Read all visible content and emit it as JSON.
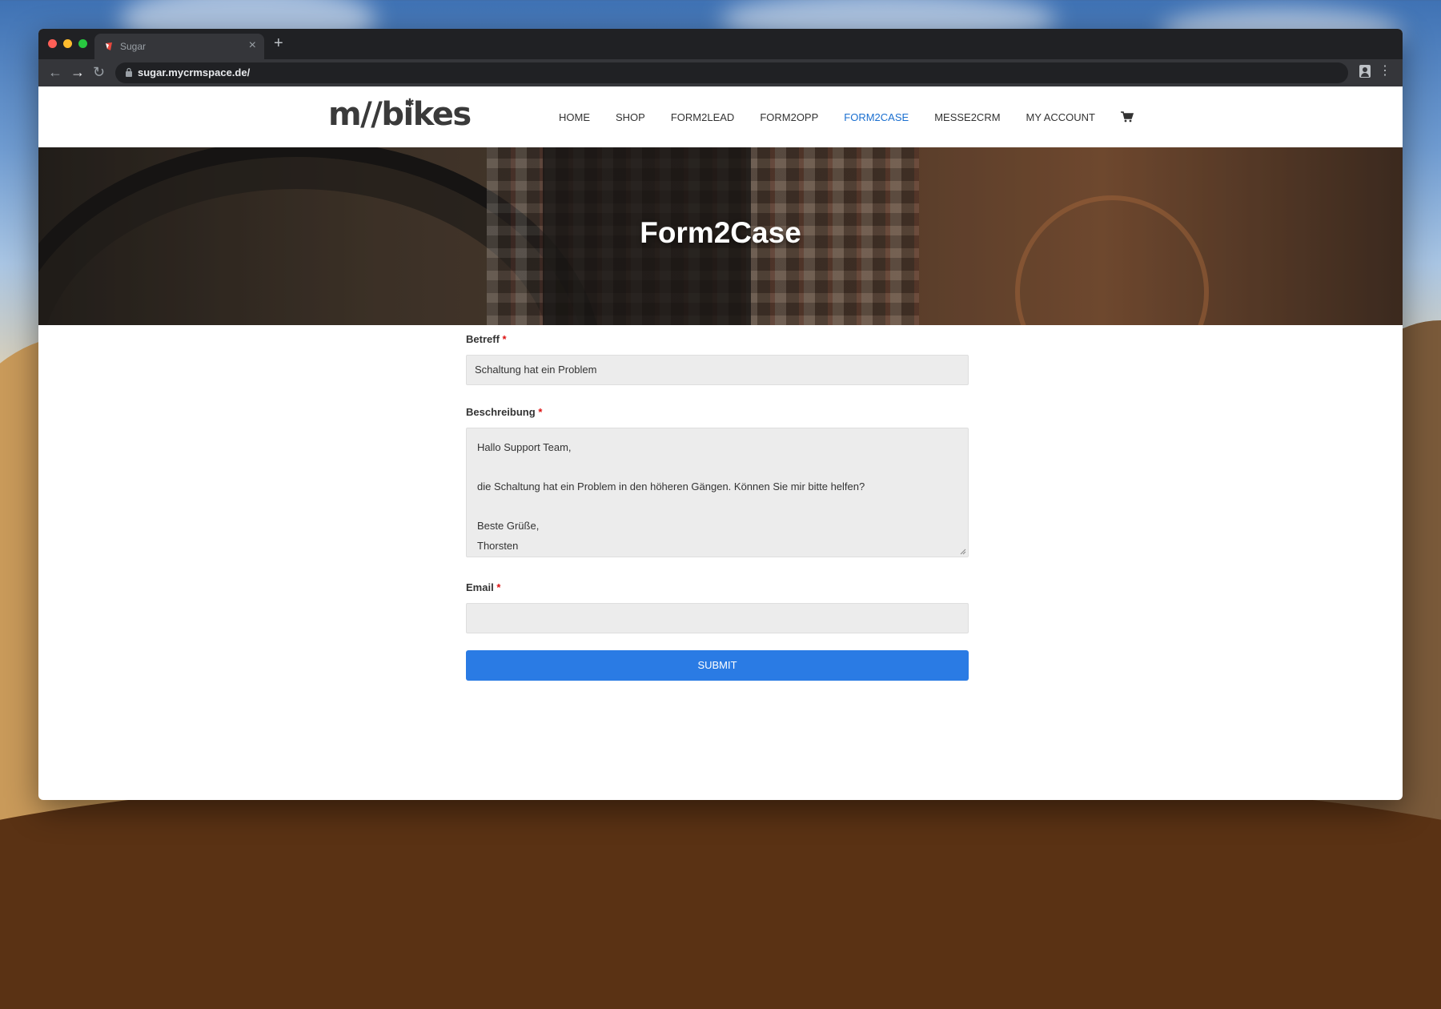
{
  "browser": {
    "tab_title": "Sugar",
    "tab_close": "×",
    "new_tab": "+",
    "url": "sugar.mycrmspace.de/",
    "back": "←",
    "forward": "→",
    "reload": "↻",
    "menu": "⋮",
    "icons": [
      "back-arrow-icon",
      "forward-arrow-icon",
      "reload-icon",
      "lock-icon",
      "profile-icon",
      "menu-dots-icon"
    ]
  },
  "site": {
    "logo": "m//bikes",
    "nav": [
      {
        "label": "HOME",
        "active": false
      },
      {
        "label": "SHOP",
        "active": false
      },
      {
        "label": "FORM2LEAD",
        "active": false
      },
      {
        "label": "FORM2OPP",
        "active": false
      },
      {
        "label": "FORM2CASE",
        "active": true
      },
      {
        "label": "MESSE2CRM",
        "active": false
      },
      {
        "label": "MY ACCOUNT",
        "active": false
      }
    ],
    "accent_color": "#1a6fd0"
  },
  "hero": {
    "title": "Form2Case"
  },
  "form": {
    "subject": {
      "label": "Betreff",
      "required_mark": "*",
      "value": "Schaltung hat ein Problem"
    },
    "description": {
      "label": "Beschreibung",
      "required_mark": "*",
      "lines": [
        "Hallo Support Team,",
        "",
        "die Schaltung hat ein Problem in den höheren Gängen. Können Sie mir bitte helfen?",
        "",
        "Beste Grüße,",
        "Thorsten"
      ]
    },
    "email": {
      "label": "Email",
      "required_mark": "*",
      "value": ""
    },
    "submit_label": "SUBMIT",
    "submit_color": "#2a7be4"
  }
}
